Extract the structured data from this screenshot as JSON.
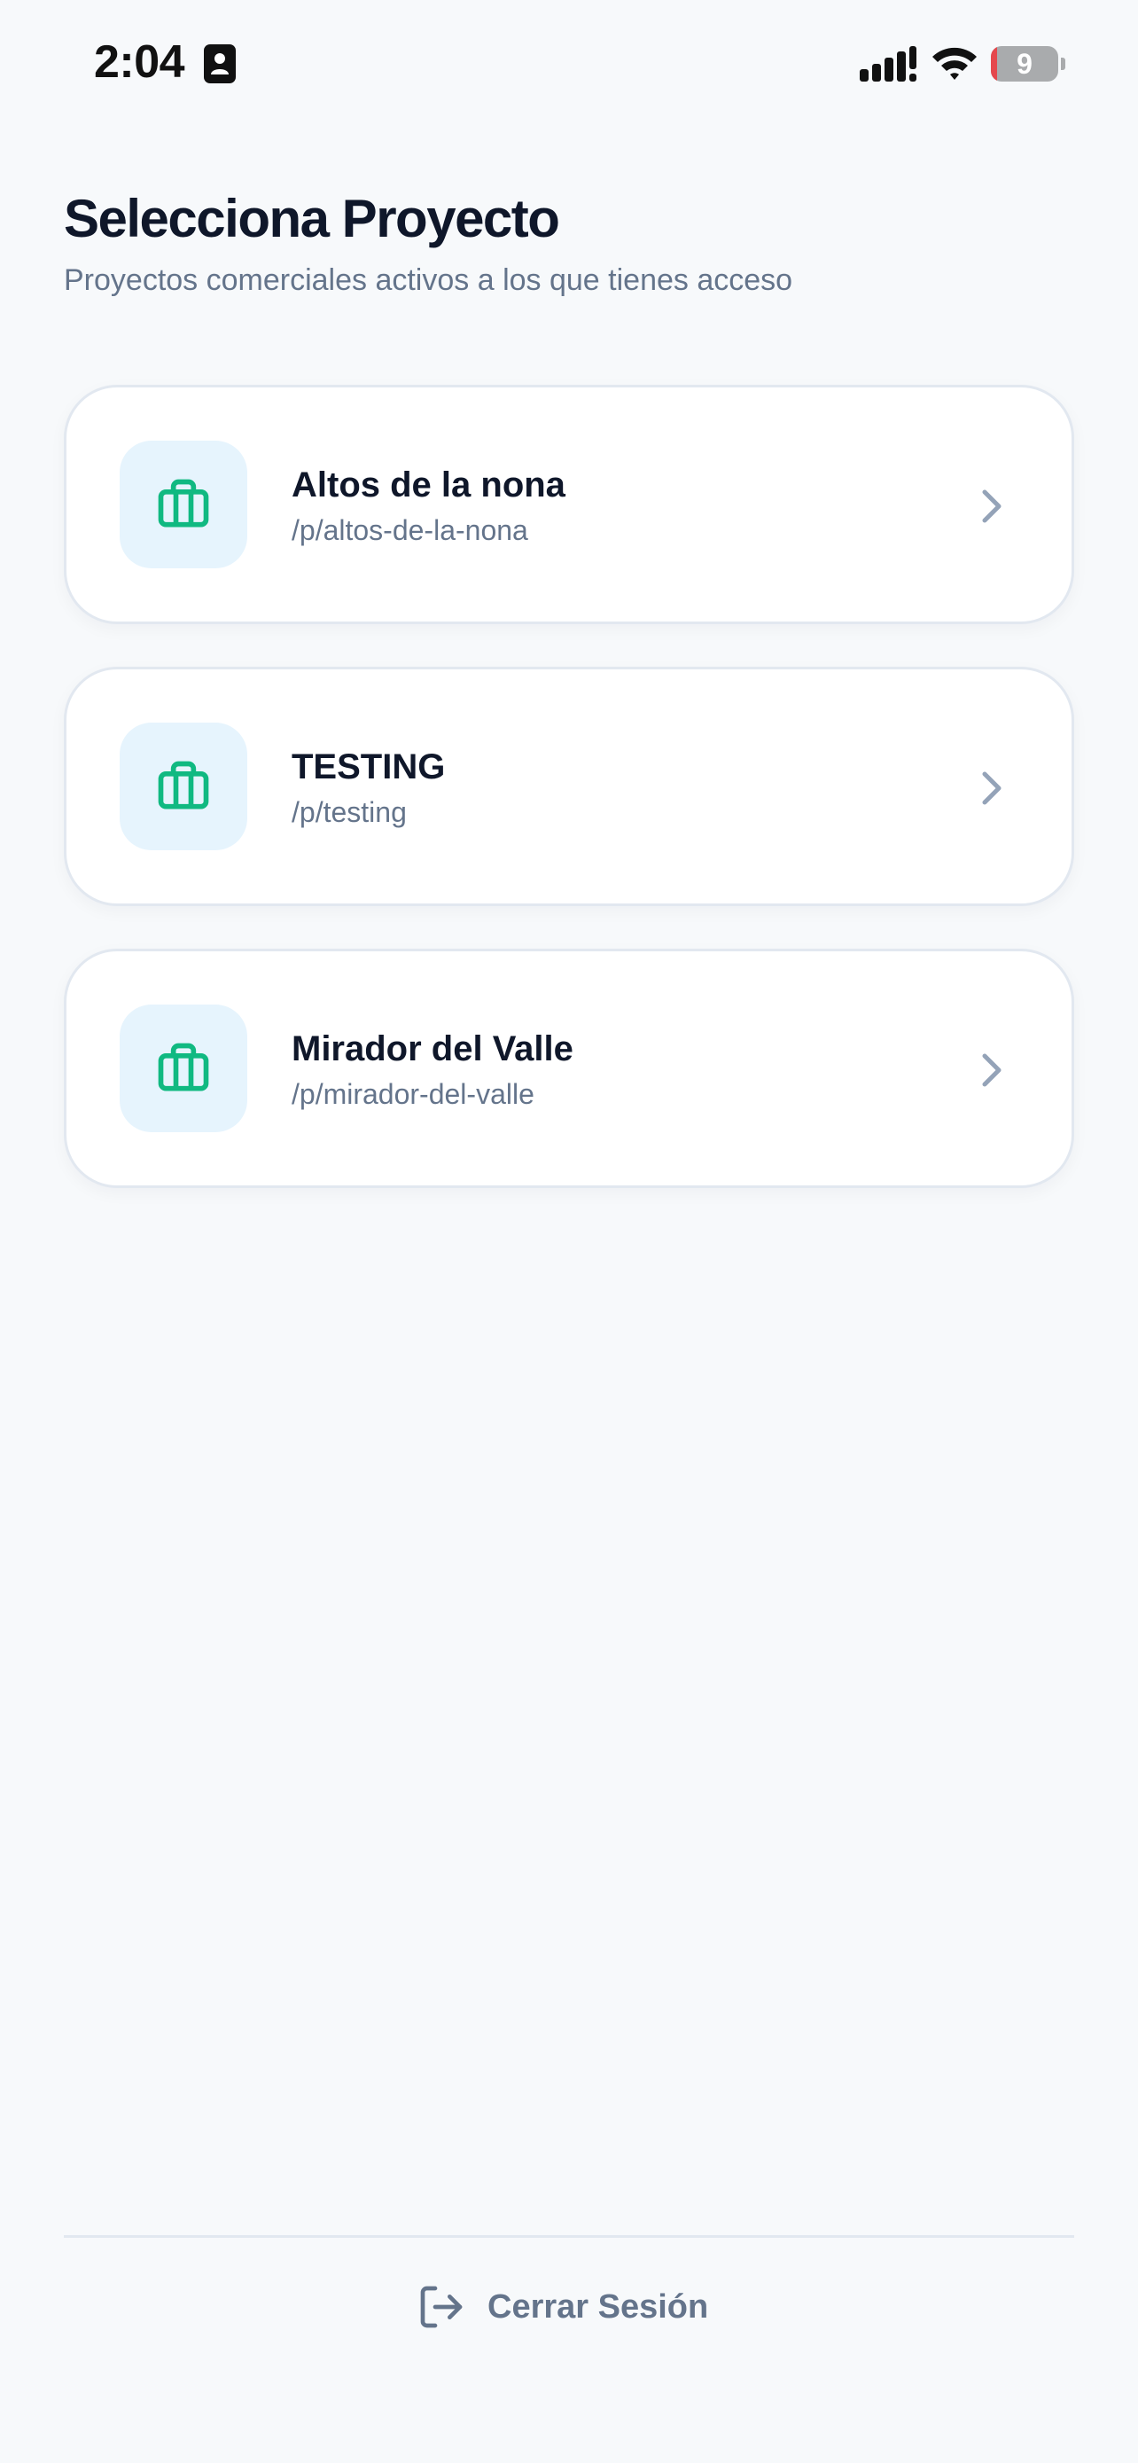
{
  "status_bar": {
    "time": "2:04",
    "battery_text": "9",
    "battery_level": 0.09
  },
  "header": {
    "title": "Selecciona Proyecto",
    "subtitle": "Proyectos comerciales activos a los que tienes acceso"
  },
  "projects": [
    {
      "name": "Altos de la nona",
      "path": "/p/altos-de-la-nona",
      "icon": "briefcase-icon"
    },
    {
      "name": "TESTING",
      "path": "/p/testing",
      "icon": "briefcase-icon"
    },
    {
      "name": "Mirador del Valle",
      "path": "/p/mirador-del-valle",
      "icon": "briefcase-icon"
    }
  ],
  "footer": {
    "logout_label": "Cerrar Sesión",
    "logout_icon": "logout-icon"
  },
  "colors": {
    "background": "#f7f9fb",
    "accent": "#10b981",
    "icon_box": "#e6f4fd",
    "title": "#0f172a",
    "muted": "#64748b",
    "border": "#e2e8f0"
  }
}
